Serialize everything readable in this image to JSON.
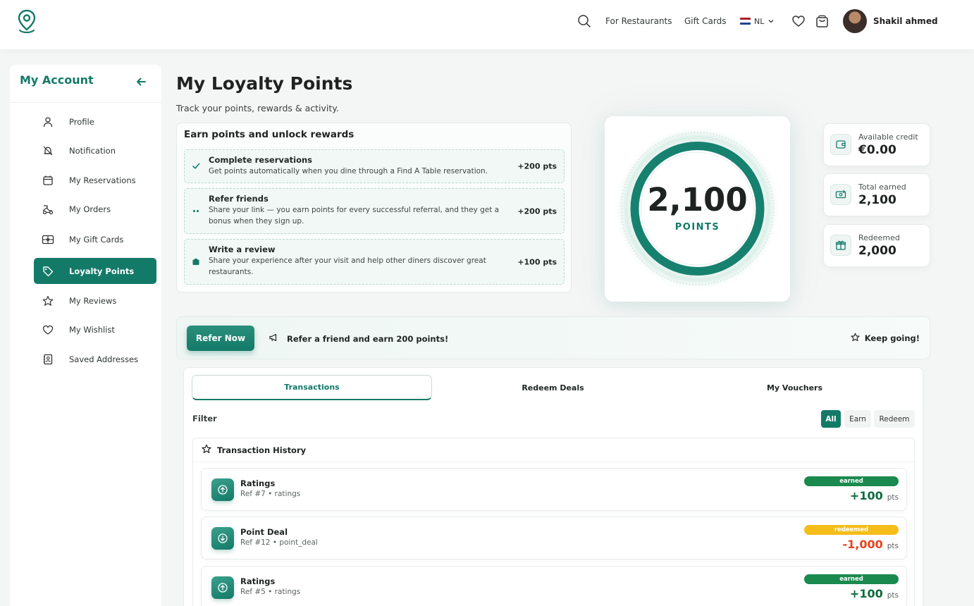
{
  "header": {
    "nav_restaurants": "For Restaurants",
    "nav_giftcards": "Gift Cards",
    "language": "NL",
    "user_name": "Shakil ahmed"
  },
  "sidebar": {
    "title": "My Account",
    "items": [
      {
        "label": "Profile",
        "icon": "user-icon"
      },
      {
        "label": "Notification",
        "icon": "bell-icon"
      },
      {
        "label": "My Reservations",
        "icon": "calendar-icon"
      },
      {
        "label": "My Orders",
        "icon": "delivery-icon"
      },
      {
        "label": "My Gift Cards",
        "icon": "gift-card-icon"
      },
      {
        "label": "Loyalty Points",
        "icon": "tag-icon",
        "active": true
      },
      {
        "label": "My Reviews",
        "icon": "star-icon"
      },
      {
        "label": "My Wishlist",
        "icon": "heart-icon"
      },
      {
        "label": "Saved Addresses",
        "icon": "address-book-icon"
      }
    ]
  },
  "page": {
    "title": "My Loyalty Points",
    "subtitle": "Track your points, rewards & activity."
  },
  "earn": {
    "title": "Earn points and unlock rewards",
    "rows": [
      {
        "title": "Complete reservations",
        "desc": "Get points automatically when you dine through a Find A Table reservation.",
        "points": "+200 pts",
        "icon": "check-icon"
      },
      {
        "title": "Refer friends",
        "desc": "Share your link — you earn points for every successful referral, and they get a bonus when they sign up.",
        "points": "+200 pts",
        "icon": "dots-icon"
      },
      {
        "title": "Write a review",
        "desc": "Share your experience after your visit and help other diners discover great restaurants.",
        "points": "+100 pts",
        "icon": "clipboard-icon"
      }
    ]
  },
  "points": {
    "value": "2,100",
    "label": "POINTS"
  },
  "stats": [
    {
      "label": "Available credit",
      "value": "€0.00",
      "icon": "wallet-icon"
    },
    {
      "label": "Total earned",
      "value": "2,100",
      "icon": "cash-icon"
    },
    {
      "label": "Redeemed",
      "value": "2,000",
      "icon": "gift-icon"
    }
  ],
  "banner": {
    "button": "Refer Now",
    "message": "Refer a friend and earn 200 points!",
    "keep_going": "Keep going!"
  },
  "tabs": [
    "Transactions",
    "Redeem Deals",
    "My Vouchers"
  ],
  "filter": {
    "label": "Filter",
    "options": [
      "All",
      "Earn",
      "Redeem"
    ],
    "selected": "All"
  },
  "history": {
    "title": "Transaction History",
    "items": [
      {
        "title": "Ratings",
        "ref": "Ref #7 • ratings",
        "badge": "earned",
        "amount": "+100",
        "unit": "pts",
        "direction": "up"
      },
      {
        "title": "Point Deal",
        "ref": "Ref #12 • point_deal",
        "badge": "redeemed",
        "amount": "-1,000",
        "unit": "pts",
        "direction": "down"
      },
      {
        "title": "Ratings",
        "ref": "Ref #5 • ratings",
        "badge": "earned",
        "amount": "+100",
        "unit": "pts",
        "direction": "up"
      }
    ]
  },
  "colors": {
    "accent": "#137a68",
    "earned_badge": "#1a8a4f",
    "redeemed_badge": "#f5bd1a",
    "earned_amount": "#0e6b3f",
    "redeemed_amount": "#e8431c"
  }
}
